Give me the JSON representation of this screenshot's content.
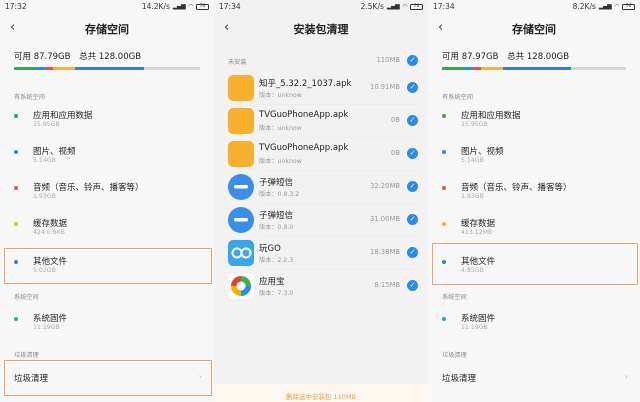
{
  "screen1": {
    "status": {
      "time": "17:32",
      "net": "14.2K/s",
      "battery": "76"
    },
    "title": "存储空间",
    "summary": {
      "available": "可用 87.79GB",
      "total": "总共 128.00GB"
    },
    "bar_fractions": [
      0.12,
      0.05,
      0.04,
      0.12,
      0.37,
      0.3
    ],
    "section_system_apps": "有系统空间",
    "items": [
      {
        "name": "应用和应用数据",
        "size": "15.95GB",
        "color": "#3fa34d"
      },
      {
        "name": "图片、视频",
        "size": "5.14GB",
        "color": "#2b8be8"
      },
      {
        "name": "音频（音乐、铃声、播客等）",
        "size": "1.93GB",
        "color": "#e0524b"
      },
      {
        "name": "缓存数据",
        "size": "424.0.6KB",
        "color": "#f0b43c"
      },
      {
        "name": "其他文件",
        "size": "5.02GB",
        "color": "#3d7fcf"
      }
    ],
    "section_system": "系统空间",
    "system_item": {
      "name": "系统固件",
      "size": "11.19GB",
      "color": "#17b3b0"
    },
    "section_clean": "垃圾清理",
    "clean": "垃圾清理",
    "chev": "›"
  },
  "screen2": {
    "status": {
      "time": "17:34",
      "net": "2.5K/s",
      "battery": "76"
    },
    "title": "安装包清理",
    "header": {
      "label": "未安装",
      "size": "110MB"
    },
    "packages": [
      {
        "name": "知乎_5.32.2_1037.apk",
        "ver": "版本：unknow",
        "size": "10.91MB",
        "icon": "folder"
      },
      {
        "name": "TVGuoPhoneApp.apk",
        "ver": "版本：unknow",
        "size": "0B",
        "icon": "folder"
      },
      {
        "name": "TVGuoPhoneApp.apk",
        "ver": "版本：unknow",
        "size": "0B",
        "icon": "folder"
      },
      {
        "name": "子弹短信",
        "ver": "版本：0.8.3.2",
        "size": "32.20MB",
        "icon": "chat"
      },
      {
        "name": "子弹短信",
        "ver": "版本：0.8.0",
        "size": "31.00MB",
        "icon": "chat"
      },
      {
        "name": "玩GO",
        "ver": "版本：2.2.3",
        "size": "18.38MB",
        "icon": "go"
      },
      {
        "name": "应用宝",
        "ver": "版本：7.3.0",
        "size": "8.15MB",
        "icon": "yyb"
      }
    ],
    "check": "✓",
    "footer": "删除选中安装包 110MB"
  },
  "screen3": {
    "status": {
      "time": "17:34",
      "net": "8.2K/s",
      "battery": "76"
    },
    "title": "存储空间",
    "summary": {
      "available": "可用 87.97GB",
      "total": "总共 128.00GB"
    },
    "bar_fractions": [
      0.12,
      0.05,
      0.04,
      0.12,
      0.37,
      0.3
    ],
    "section_system_apps": "有系统空间",
    "items": [
      {
        "name": "应用和应用数据",
        "size": "15.95GB",
        "color": "#3fa34d"
      },
      {
        "name": "图片、视频",
        "size": "5.14GB",
        "color": "#2b8be8"
      },
      {
        "name": "音频（音乐、铃声、播客等）",
        "size": "1.93GB",
        "color": "#e0524b"
      },
      {
        "name": "缓存数据",
        "size": "413.12MB",
        "color": "#f0b43c"
      },
      {
        "name": "其他文件",
        "size": "4.85GB",
        "color": "#3d7fcf"
      }
    ],
    "section_system": "系统空间",
    "system_item": {
      "name": "系统固件",
      "size": "11.19GB",
      "color": "#17b3b0"
    },
    "section_clean": "垃圾清理",
    "clean": "垃圾清理",
    "chev": "›"
  },
  "bar_colors": [
    "#3fa34d",
    "#2b8be8",
    "#e0524b",
    "#f0b43c",
    "#3d7fcf",
    "#d8d8d8"
  ],
  "highlight_color": "#e8a36e",
  "accent": "#2b8be8"
}
